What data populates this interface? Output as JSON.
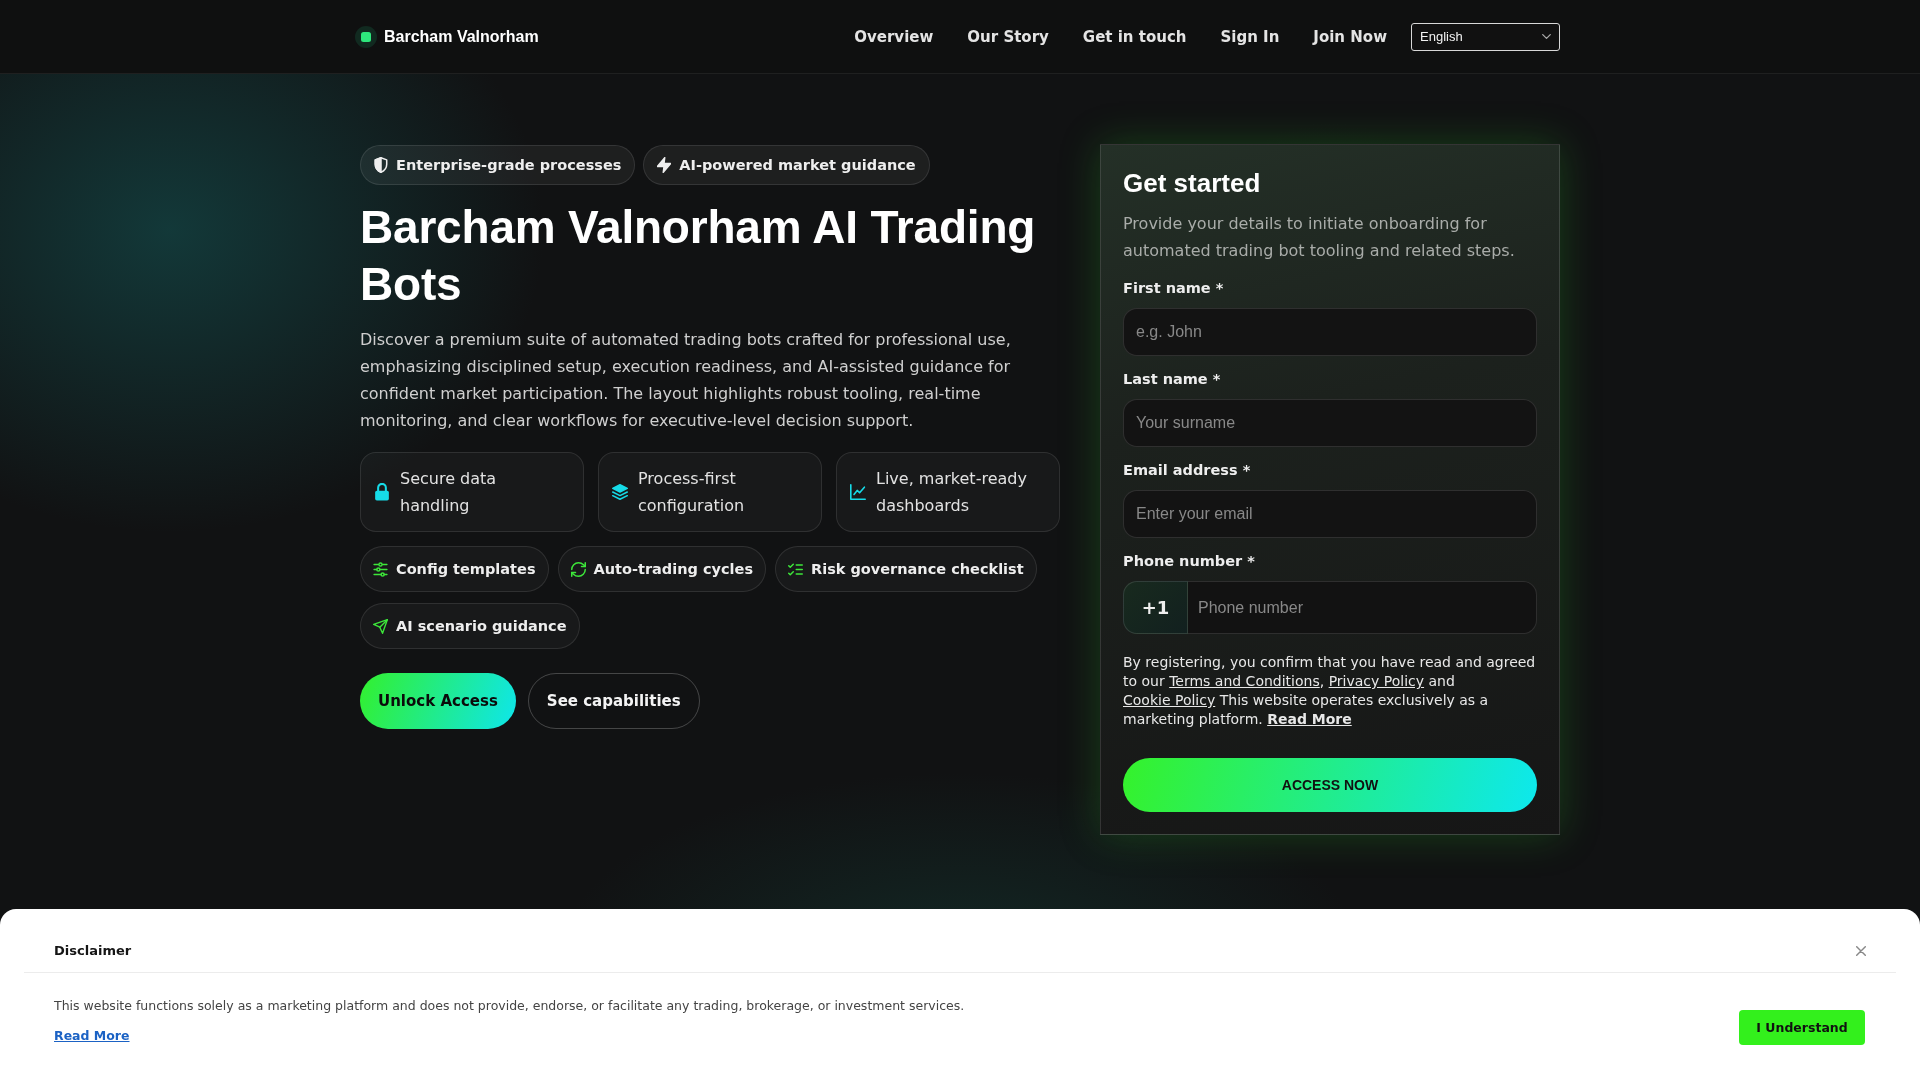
{
  "header": {
    "brand": "Barcham Valnorham",
    "nav": [
      "Overview",
      "Our Story",
      "Get in touch",
      "Sign In",
      "Join Now"
    ],
    "language": "English"
  },
  "hero": {
    "badges": [
      "Enterprise-grade processes",
      "AI-powered market guidance"
    ],
    "title": "Barcham Valnorham AI Trading Bots",
    "description": "Discover a premium suite of automated trading bots crafted for professional use, emphasizing disciplined setup, execution readiness, and AI-assisted guidance for confident market participation. The layout highlights robust tooling, real-time monitoring, and clear workflows for executive-level decision support.",
    "features": [
      "Secure data handling",
      "Process-first configuration",
      "Live, market-ready dashboards"
    ],
    "tags": [
      "Config templates",
      "Auto-trading cycles",
      "Risk governance checklist",
      "AI scenario guidance"
    ],
    "buttons": [
      {
        "kind": "primary",
        "label": "Unlock Access"
      },
      {
        "kind": "secondary",
        "label": "See capabilities"
      }
    ]
  },
  "signup": {
    "title": "Get started",
    "description": "Provide your details to initiate onboarding for automated trading bot tooling and related steps.",
    "fields": [
      {
        "kind": "text",
        "label": "First name *",
        "placeholder": "e.g. John"
      },
      {
        "kind": "text",
        "label": "Last name *",
        "placeholder": "Your surname"
      },
      {
        "kind": "text",
        "label": "Email address *",
        "placeholder": "Enter your email"
      },
      {
        "kind": "phone",
        "label": "Phone number *",
        "prefix": "+1",
        "placeholder": "Phone number"
      }
    ],
    "consent": [
      {
        "kind": "text",
        "text": "By registering, you confirm that you have read and agreed to our "
      },
      {
        "kind": "link",
        "text": "Terms and Conditions"
      },
      {
        "kind": "text",
        "text": ", "
      },
      {
        "kind": "link",
        "text": "Privacy Policy"
      },
      {
        "kind": "text",
        "text": " and "
      },
      {
        "kind": "link",
        "text": "Cookie Policy"
      },
      {
        "kind": "text",
        "text": " This website operates exclusively as a marketing platform. "
      },
      {
        "kind": "bold_link",
        "text": "Read More"
      }
    ],
    "submit": "ACCESS NOW"
  },
  "disclaimer": {
    "title": "Disclaimer",
    "text": "This website functions solely as a marketing platform and does not provide, endorse, or facilitate any trading, brokerage, or investment services.",
    "link": "Read More",
    "button": "I Understand"
  }
}
